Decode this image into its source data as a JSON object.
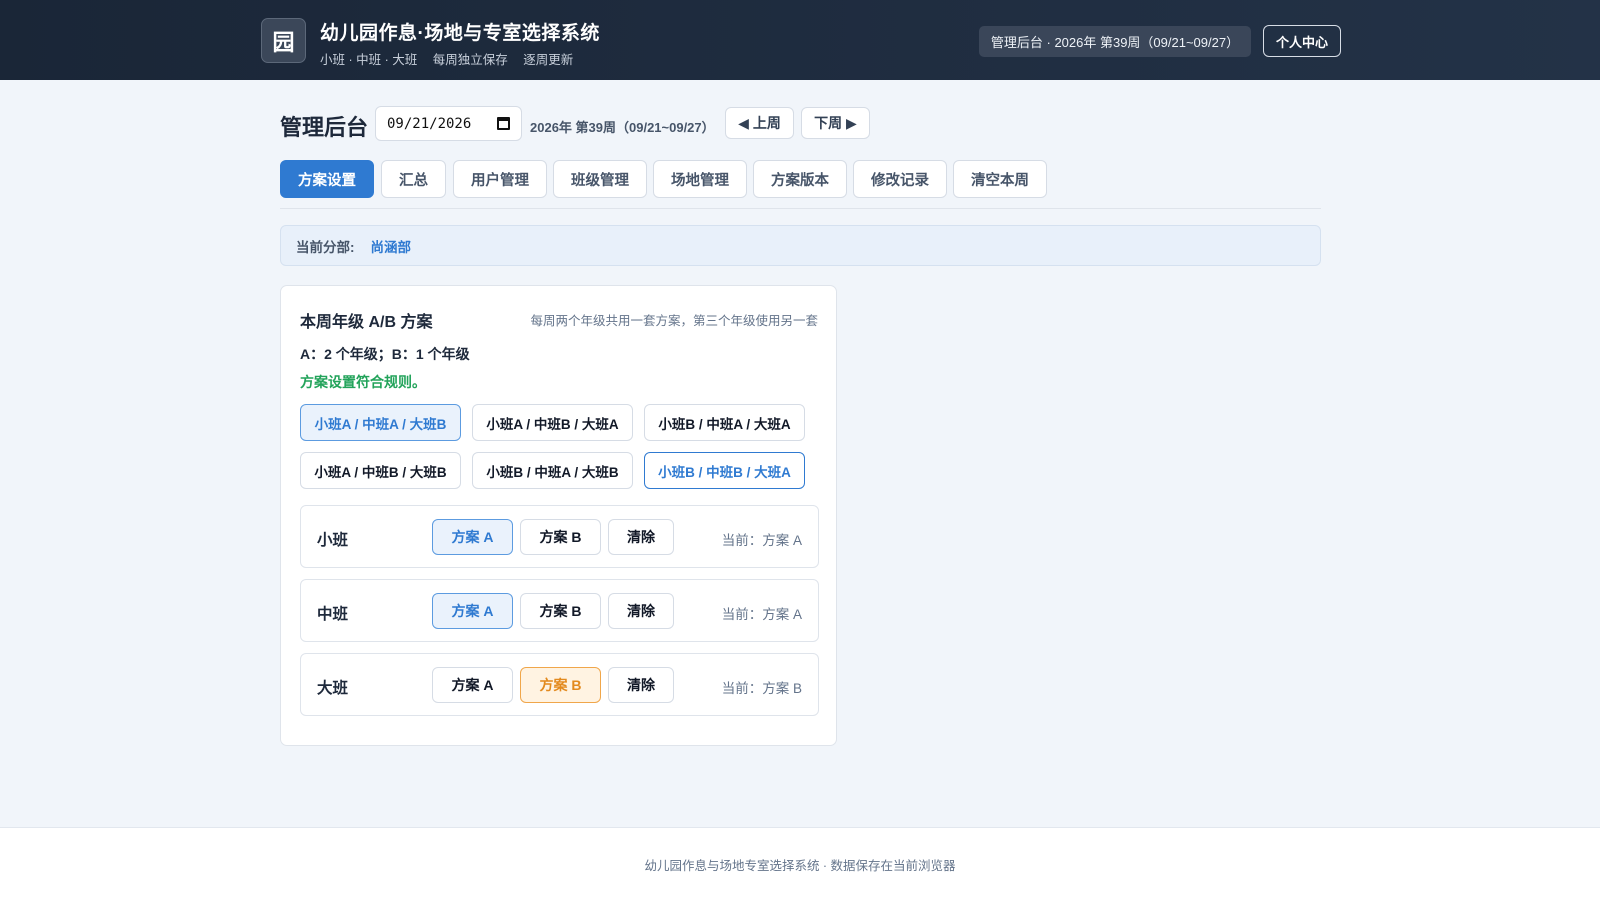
{
  "header": {
    "logo_char": "园",
    "title": "幼儿园作息·场地与专室选择系统",
    "subtitle_parts": [
      "小班 · 中班 · 大班",
      "每周独立保存",
      "逐周更新"
    ],
    "week_pill": "管理后台 · 2026年 第39周（09/21~09/27）",
    "profile_button": "个人中心"
  },
  "toolbar": {
    "heading": "管理后台",
    "date_value": "09/21/2026",
    "week_label": "2026年 第39周（09/21~09/27）",
    "prev_button": "◀ 上周",
    "next_button": "下周 ▶"
  },
  "tabs": [
    {
      "label": "方案设置",
      "active": true
    },
    {
      "label": "汇总",
      "active": false
    },
    {
      "label": "用户管理",
      "active": false
    },
    {
      "label": "班级管理",
      "active": false
    },
    {
      "label": "场地管理",
      "active": false
    },
    {
      "label": "方案版本",
      "active": false
    },
    {
      "label": "修改记录",
      "active": false
    },
    {
      "label": "清空本周",
      "active": false
    }
  ],
  "branch": {
    "label": "当前分部:",
    "value": "尚涵部"
  },
  "plan_card": {
    "title": "本周年级 A/B 方案",
    "hint": "每周两个年级共用一套方案，第三个年级使用另一套",
    "rule": "A：2 个年级；B：1 个年级",
    "status": "方案设置符合规则。",
    "combos": [
      "小班A / 中班A / 大班B",
      "小班A / 中班B / 大班A",
      "小班B / 中班A / 大班A",
      "小班A / 中班B / 大班B",
      "小班B / 中班A / 大班B",
      "小班B / 中班B / 大班A"
    ],
    "grades": [
      {
        "name": "小班",
        "opt_a": "方案 A",
        "opt_b": "方案 B",
        "clear": "清除",
        "current": "当前：方案 A",
        "selected": "A"
      },
      {
        "name": "中班",
        "opt_a": "方案 A",
        "opt_b": "方案 B",
        "clear": "清除",
        "current": "当前：方案 A",
        "selected": "A"
      },
      {
        "name": "大班",
        "opt_a": "方案 A",
        "opt_b": "方案 B",
        "clear": "清除",
        "current": "当前：方案 B",
        "selected": "B"
      }
    ]
  },
  "footer": {
    "text": "幼儿园作息与场地专室选择系统 · 数据保存在当前浏览器"
  },
  "colors": {
    "header_bg": "#1a2637",
    "accent": "#2f7ad1",
    "success": "#22a35a",
    "plan_b": "#e38a1e"
  }
}
